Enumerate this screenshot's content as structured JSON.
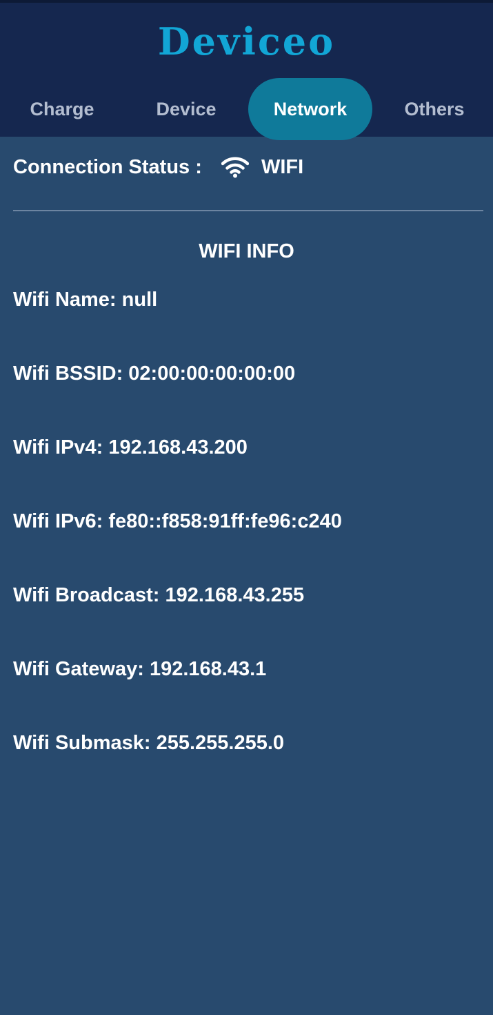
{
  "app": {
    "title": "Deviceo"
  },
  "tabs": [
    {
      "label": "Charge",
      "active": false
    },
    {
      "label": "Device",
      "active": false
    },
    {
      "label": "Network",
      "active": true
    },
    {
      "label": "Others",
      "active": false
    }
  ],
  "connection": {
    "label": "Connection Status : ",
    "icon": "wifi-icon",
    "value": "WIFI"
  },
  "wifi_info": {
    "title": "WIFI INFO",
    "rows": [
      {
        "label": "Wifi Name: ",
        "value": "null"
      },
      {
        "label": "Wifi BSSID: ",
        "value": "02:00:00:00:00:00"
      },
      {
        "label": "Wifi IPv4: ",
        "value": "192.168.43.200"
      },
      {
        "label": "Wifi IPv6: ",
        "value": "fe80::f858:91ff:fe96:c240"
      },
      {
        "label": "Wifi Broadcast: ",
        "value": "192.168.43.255"
      },
      {
        "label": "Wifi Gateway: ",
        "value": "192.168.43.1"
      },
      {
        "label": "Wifi Submask: ",
        "value": "255.255.255.0"
      }
    ]
  },
  "colors": {
    "header_bg": "#15274f",
    "body_bg": "#284a6e",
    "accent": "#0f7a9a",
    "title": "#12a6d6"
  }
}
